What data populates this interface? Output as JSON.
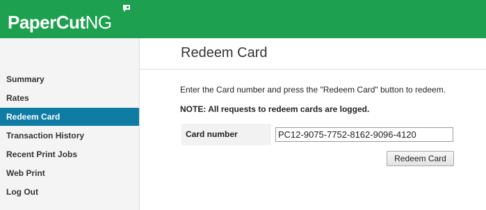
{
  "header": {
    "logo_brand": "PaperCut",
    "logo_suffix": "NG",
    "background": "#1da050"
  },
  "sidebar": {
    "items": [
      {
        "label": "Summary",
        "active": false
      },
      {
        "label": "Rates",
        "active": false
      },
      {
        "label": "Redeem Card",
        "active": true
      },
      {
        "label": "Transaction History",
        "active": false
      },
      {
        "label": "Recent Print Jobs",
        "active": false
      },
      {
        "label": "Web Print",
        "active": false
      },
      {
        "label": "Log Out",
        "active": false
      }
    ],
    "active_color": "#0e7ca3"
  },
  "main": {
    "title": "Redeem Card",
    "instructions": "Enter the Card number and press the \"Redeem Card\" button to redeem.",
    "note": "NOTE: All requests to redeem cards are logged.",
    "form": {
      "card_number_label": "Card number",
      "card_number_value": "PC12-9075-7752-8162-9096-4120",
      "submit_label": "Redeem Card"
    }
  }
}
